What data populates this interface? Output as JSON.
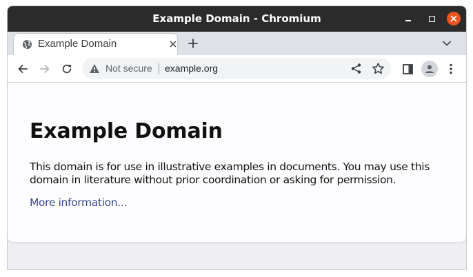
{
  "window": {
    "title": "Example Domain - Chromium"
  },
  "tabs": [
    {
      "label": "Example Domain",
      "active": true
    }
  ],
  "toolbar": {
    "security_label": "Not secure",
    "url": "example.org"
  },
  "page": {
    "heading": "Example Domain",
    "paragraph": "This domain is for use in illustrative examples in documents. You may use this domain in literature without prior coordination or asking for permission.",
    "link_text": "More information..."
  },
  "colors": {
    "titlebar": "#2b2b2b",
    "close_button": "#e95420",
    "link": "#38488f"
  },
  "icons": [
    "globe-icon",
    "close-icon",
    "plus-icon",
    "chevron-down-icon",
    "back-arrow-icon",
    "forward-arrow-icon",
    "reload-icon",
    "warning-icon",
    "share-icon",
    "star-icon",
    "side-panel-icon",
    "profile-icon",
    "kebab-menu-icon",
    "minimize-icon",
    "maximize-icon"
  ]
}
